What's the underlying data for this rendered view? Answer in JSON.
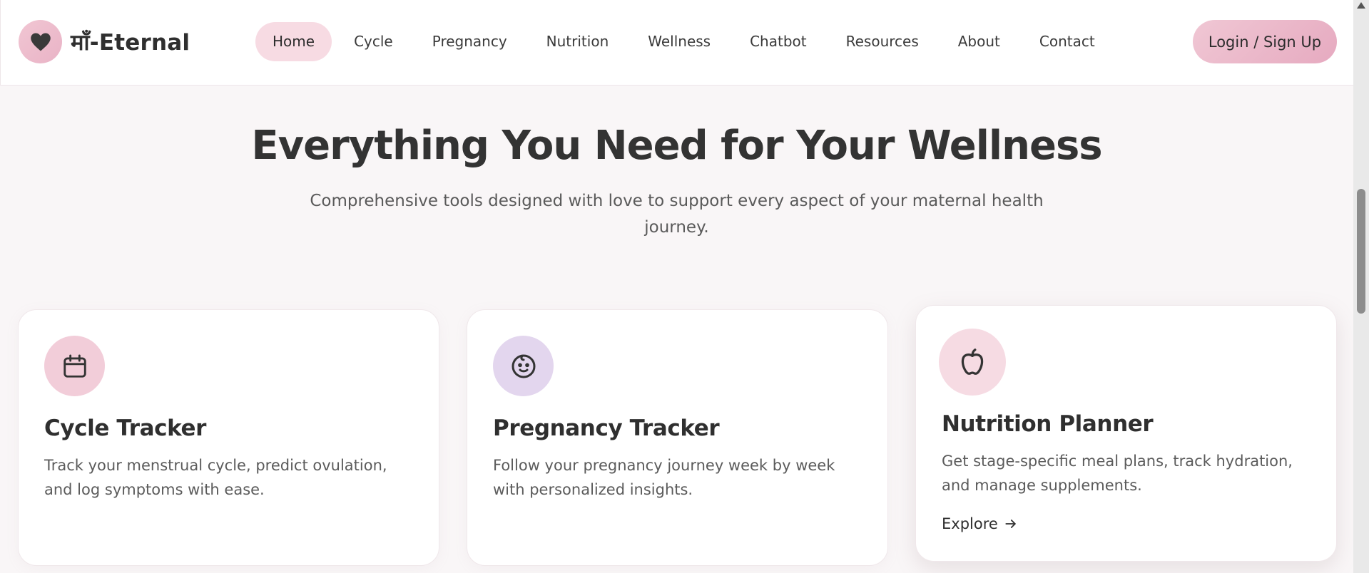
{
  "brand": {
    "name": "माँ-Eternal",
    "logo_icon": "heart-icon"
  },
  "nav": {
    "items": [
      {
        "label": "Home",
        "active": true
      },
      {
        "label": "Cycle"
      },
      {
        "label": "Pregnancy"
      },
      {
        "label": "Nutrition"
      },
      {
        "label": "Wellness"
      },
      {
        "label": "Chatbot"
      },
      {
        "label": "Resources"
      },
      {
        "label": "About"
      },
      {
        "label": "Contact"
      }
    ],
    "login_label": "Login / Sign Up"
  },
  "section": {
    "title": "Everything You Need for Your Wellness",
    "subtitle": "Comprehensive tools designed with love to support every aspect of your maternal health journey."
  },
  "cards": [
    {
      "icon": "calendar-icon",
      "icon_bg": "#f2cdd9",
      "title": "Cycle Tracker",
      "description": "Track your menstrual cycle, predict ovulation, and log symptoms with ease."
    },
    {
      "icon": "baby-face-icon",
      "icon_bg": "#e3d6ee",
      "title": "Pregnancy Tracker",
      "description": "Follow your pregnancy journey week by week with personalized insights."
    },
    {
      "icon": "apple-icon",
      "icon_bg": "#f6dbe3",
      "title": "Nutrition Planner",
      "description": "Get stage-specific meal plans, track hydration, and manage supplements.",
      "link_label": "Explore"
    }
  ],
  "colors": {
    "accent_pink": "#f7dbe3",
    "button_gradient": [
      "#f0c7d4",
      "#e6aac0"
    ],
    "background": "#f9f6f7"
  }
}
